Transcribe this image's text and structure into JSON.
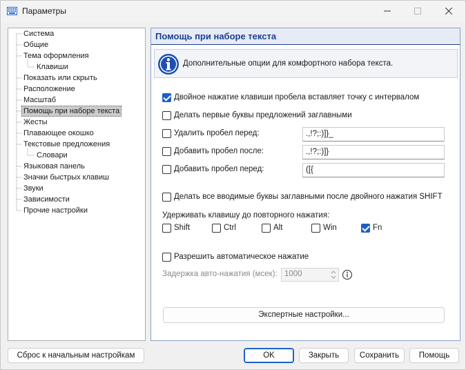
{
  "window": {
    "title": "Параметры"
  },
  "tree": {
    "items": [
      {
        "label": "Система"
      },
      {
        "label": "Общие"
      },
      {
        "label": "Тема оформления"
      },
      {
        "label": "Клавиши"
      },
      {
        "label": "Показать или скрыть"
      },
      {
        "label": "Расположение"
      },
      {
        "label": "Масштаб"
      },
      {
        "label": "Помощь при наборе текста"
      },
      {
        "label": "Жесты"
      },
      {
        "label": "Плавающее окошко"
      },
      {
        "label": "Текстовые предложения"
      },
      {
        "label": "Словари"
      },
      {
        "label": "Языковая панель"
      },
      {
        "label": "Значки быстрых клавиш"
      },
      {
        "label": "Звуки"
      },
      {
        "label": "Зависимости"
      },
      {
        "label": "Прочие настройки"
      }
    ]
  },
  "panel": {
    "title": "Помощь при наборе текста",
    "info": "Дополнительные опции для комфортного набора текста.",
    "double_space": {
      "label": "Двойное нажатие клавиши пробела вставляет точку с интервалом",
      "checked": true
    },
    "capitalize_first": {
      "label": "Делать первые буквы предложений заглавными",
      "checked": false
    },
    "remove_space_before": {
      "label": "Удалить пробел перед:",
      "checked": false,
      "value": ".,!?;:)]}_"
    },
    "add_space_after": {
      "label": "Добавить пробел после:",
      "checked": false,
      "value": ".,!?;:)]}"
    },
    "add_space_before": {
      "label": "Добавить пробел перед:",
      "checked": false,
      "value": "([{"
    },
    "caps_after_shift": {
      "label": "Делать все вводимые буквы заглавными после двойного нажатия SHIFT",
      "checked": false
    },
    "hold_keys_label": "Удерживать клавишу до повторного нажатия:",
    "hold_keys": [
      {
        "label": "Shift",
        "checked": false
      },
      {
        "label": "Ctrl",
        "checked": false
      },
      {
        "label": "Alt",
        "checked": false
      },
      {
        "label": "Win",
        "checked": false
      },
      {
        "label": "Fn",
        "checked": true
      }
    ],
    "auto_press": {
      "label": "Разрешить автоматическое нажатие",
      "checked": false
    },
    "delay_label": "Задержка авто-нажатия (мсек):",
    "delay_value": "1000",
    "expert_button": "Экспертные настройки..."
  },
  "footer": {
    "reset": "Сброс к начальным настройкам",
    "ok": "OK",
    "close": "Закрыть",
    "save": "Сохранить",
    "help": "Помощь"
  },
  "colors": {
    "accent": "#1d5fc9",
    "header_text": "#1c3f94"
  }
}
